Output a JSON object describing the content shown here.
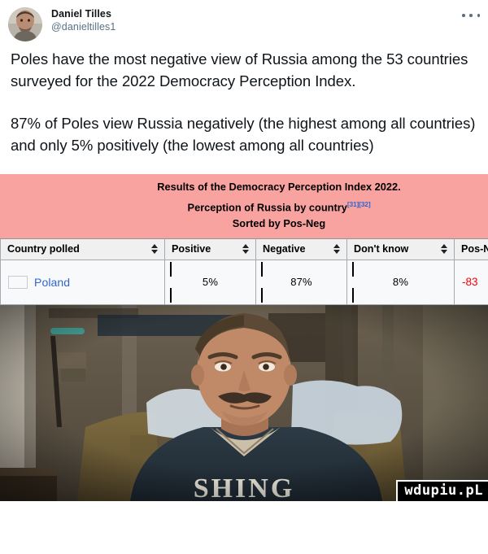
{
  "tweet": {
    "display_name": "Daniel Tilles",
    "handle": "@danieltilles1",
    "more_label": "More",
    "paragraphs": [
      "Poles have the most negative view of Russia among the 53 countries surveyed for the 2022 Democracy Perception Index.",
      "87% of Poles view Russia negatively (the highest among all countries) and only 5% positively (the lowest among all countries)"
    ]
  },
  "table": {
    "caption_lines": [
      "Results of the Democracy Perception Index 2022.",
      "Perception of Russia by country",
      "Sorted by Pos-Neg"
    ],
    "caption_refs": "[31][32]",
    "headers": [
      "Country polled",
      "Positive",
      "Negative",
      "Don't know",
      "Pos-Neg"
    ],
    "rows": [
      {
        "country": "Poland",
        "flag": "poland-flag",
        "positive": "5%",
        "negative": "87%",
        "dont_know": "8%",
        "pos_neg": "-83"
      }
    ],
    "colors": {
      "caption_bg": "#f9a3a0",
      "positive_fill": "#66ff66",
      "negative_fill": "#f98a85",
      "dont_know_fill": "#e8e8e8",
      "pos_neg_text": "#ff0000",
      "link": "#3366cc"
    }
  },
  "chart_data": {
    "type": "bar",
    "title": "Results of the Democracy Perception Index 2022. Perception of Russia by country",
    "subtitle": "Sorted by Pos-Neg",
    "categories": [
      "Positive",
      "Negative",
      "Don't know"
    ],
    "values": [
      5,
      87,
      8
    ],
    "country": "Poland",
    "pos_neg": -83,
    "unit": "%",
    "xlabel": "",
    "ylabel": "",
    "ylim": [
      0,
      100
    ],
    "grid": false,
    "legend": "none"
  },
  "photo": {
    "alt": "Man with moustache sitting in an armchair wearing a dark FISHING sweatshirt",
    "sweatshirt_text": "SHING",
    "watermark": "wdupiu.pL"
  }
}
